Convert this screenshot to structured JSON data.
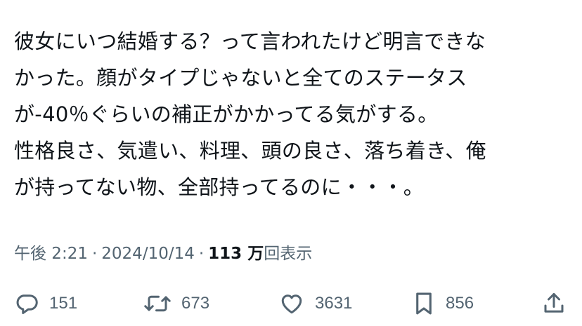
{
  "tweet": {
    "lines": [
      "彼女にいつ結婚する？って言われたけど明言できな",
      "かった。顔がタイプじゃないと全てのステータス",
      "が-40％ぐらいの補正がかかってる気がする。",
      "性格良さ、気遣い、料理、頭の良さ、落ち着き、俺",
      "が持ってない物、全部持ってるのに・・・。"
    ]
  },
  "meta": {
    "time": "午後 2:21",
    "separator": "·",
    "date": "2024/10/14",
    "views_count": "113 万",
    "views_label": "回表示"
  },
  "actions": {
    "reply": {
      "icon": "reply-icon",
      "count": "151"
    },
    "retweet": {
      "icon": "retweet-icon",
      "count": "673"
    },
    "like": {
      "icon": "heart-icon",
      "count": "3631"
    },
    "bookmark": {
      "icon": "bookmark-icon",
      "count": "856"
    },
    "share": {
      "icon": "share-icon"
    }
  },
  "colors": {
    "text": "#0f1419",
    "secondary": "#536471",
    "background": "#ffffff"
  }
}
